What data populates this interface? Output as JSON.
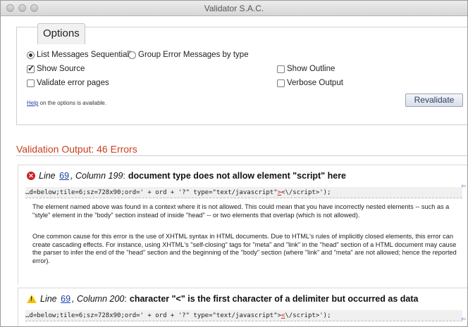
{
  "window": {
    "title": "Validator S.A.C."
  },
  "options": {
    "tab_label": "Options",
    "list_sequential": "List Messages Sequentially",
    "group_by_type": "Group Error Messages by type",
    "show_source": "Show Source",
    "show_outline": "Show Outline",
    "validate_error_pages": "Validate error pages",
    "verbose_output": "Verbose Output",
    "help_link": "Help",
    "help_text": " on the options is available.",
    "revalidate_label": "Revalidate",
    "state": {
      "list_sequential": true,
      "group_by_type": false,
      "show_source": true,
      "show_outline": false,
      "validate_error_pages": false,
      "verbose_output": false
    }
  },
  "output": {
    "heading": "Validation Output: 46 Errors",
    "messages": [
      {
        "type": "error",
        "icon": "error-icon",
        "line_label": "Line",
        "line": "69",
        "column_text": ", Column 199",
        "title": "document type does not allow element \"script\" here",
        "code_before": "…d=below;tile=6;sz=728x90;ord=' + ord + '?\" type=\"text/javascript\"",
        "code_highlight": ">",
        "code_after": "<\\/script>');",
        "para1": "The element named above was found in a context where it is not allowed. This could mean that you have incorrectly nested elements -- such as a \"style\" element in the \"body\" section instead of inside \"head\" -- or two elements that overlap (which is not allowed).",
        "para2": "One common cause for this error is the use of XHTML syntax in HTML documents. Due to HTML's rules of implicitly closed elements, this error can create cascading effects. For instance, using XHTML's \"self-closing\" tags for \"meta\" and \"link\" in the \"head\" section of a HTML document may cause the parser to infer the end of the \"head\" section and the beginning of the \"body\" section (where \"link\" and \"meta\" are not allowed; hence the reported error)."
      },
      {
        "type": "warning",
        "icon": "warning-icon",
        "line_label": "Line",
        "line": "69",
        "column_text": ", Column 200",
        "title": "character \"<\" is the first character of a delimiter but occurred as data",
        "code_before": "…d=below;tile=6;sz=728x90;ord=' + ord + '?\" type=\"text/javascript\">",
        "code_highlight": "<",
        "code_after": "\\/script>');"
      }
    ]
  },
  "colors": {
    "heading": "#c8401e",
    "link": "#1a3fa8",
    "error": "#d02020",
    "warning": "#f0c400"
  }
}
